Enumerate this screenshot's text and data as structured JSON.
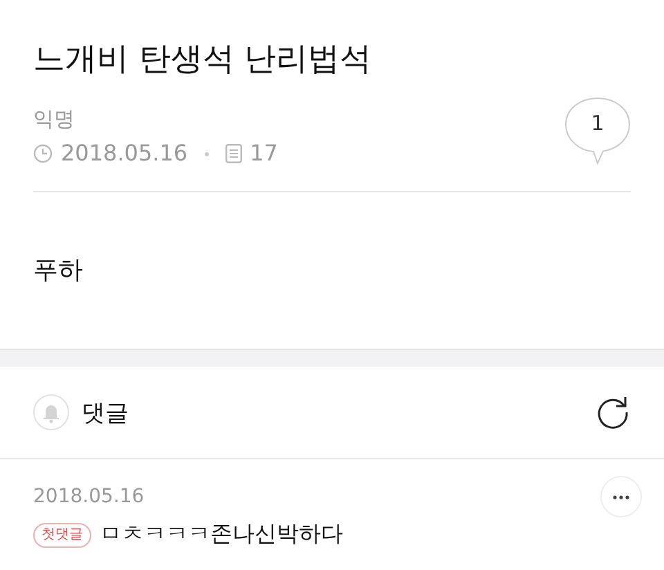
{
  "post": {
    "title": "느개비 탄생석 난리법석",
    "author": "익명",
    "date": "2018.05.16",
    "views": "17",
    "comment_count": "1",
    "body": "푸하"
  },
  "comments_section": {
    "title": "댓글"
  },
  "comments": [
    {
      "date": "2018.05.16",
      "badge": "첫댓글",
      "text": "ㅁㅊㅋㅋㅋ존나신박하다"
    }
  ]
}
